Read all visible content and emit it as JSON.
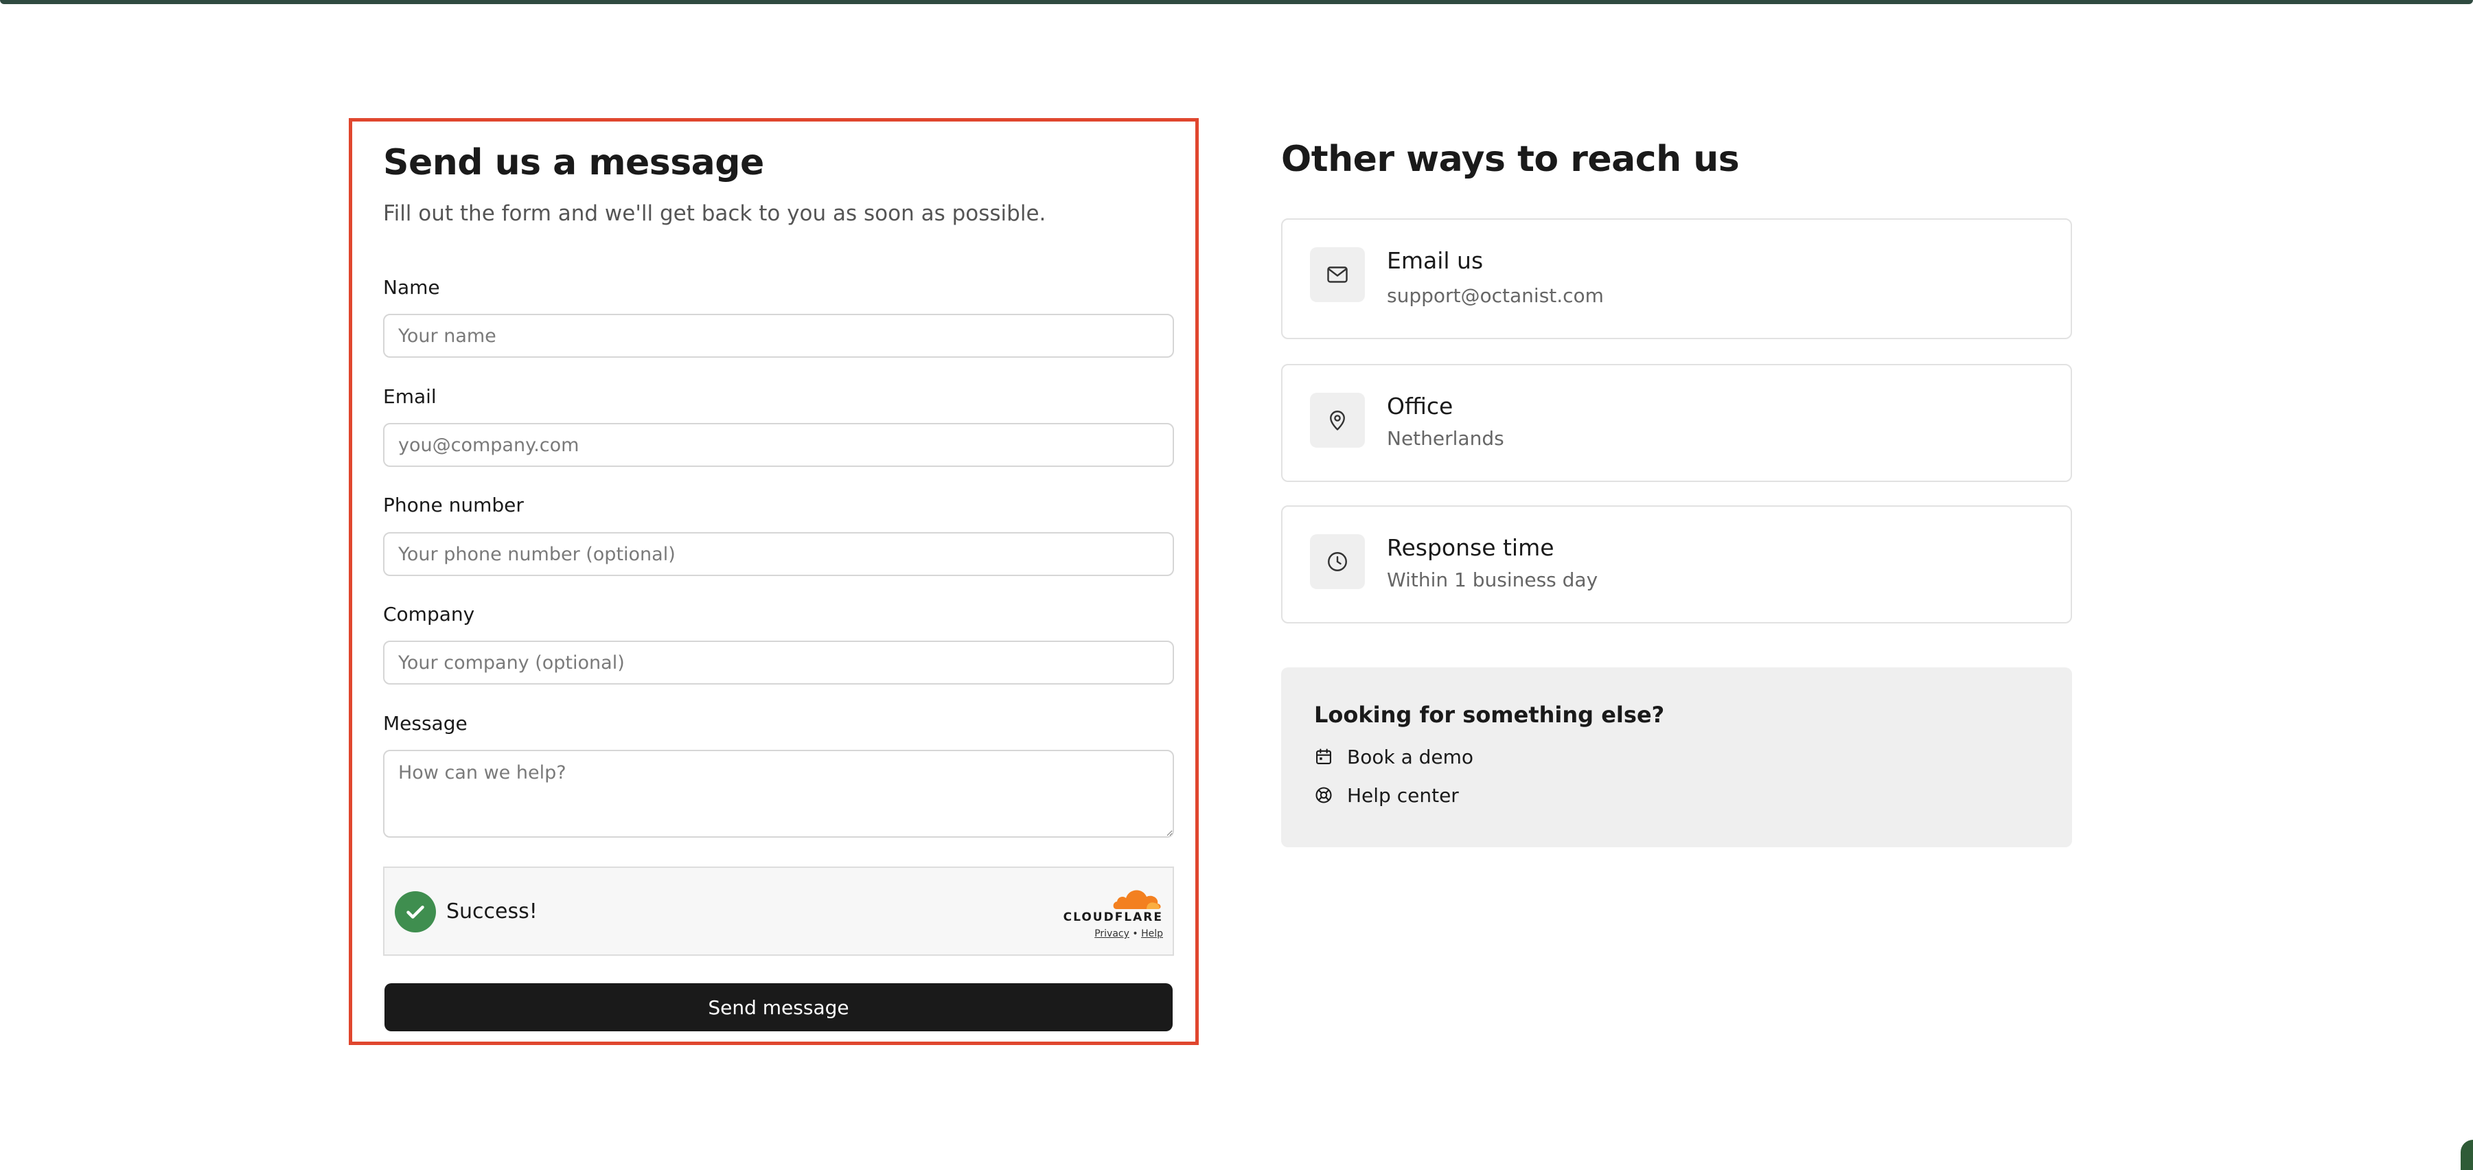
{
  "form": {
    "title": "Send us a message",
    "subtitle": "Fill out the form and we'll get back to you as soon as possible.",
    "fields": {
      "name": {
        "label": "Name",
        "placeholder": "Your name",
        "value": ""
      },
      "email": {
        "label": "Email",
        "placeholder": "you@company.com",
        "value": ""
      },
      "phone": {
        "label": "Phone number",
        "placeholder": "Your phone number (optional)",
        "value": ""
      },
      "company": {
        "label": "Company",
        "placeholder": "Your company (optional)",
        "value": ""
      },
      "message": {
        "label": "Message",
        "placeholder": "How can we help?",
        "value": ""
      }
    },
    "captcha": {
      "status": "Success!",
      "brand": "CLOUDFLARE",
      "privacy_label": "Privacy",
      "separator": "•",
      "help_label": "Help"
    },
    "submit_label": "Send message"
  },
  "contact": {
    "title": "Other ways to reach us",
    "cards": [
      {
        "icon": "mail-icon",
        "title": "Email us",
        "subtitle": "support@octanist.com"
      },
      {
        "icon": "map-pin-icon",
        "title": "Office",
        "subtitle": "Netherlands"
      },
      {
        "icon": "clock-icon",
        "title": "Response time",
        "subtitle": "Within 1 business day"
      }
    ],
    "else": {
      "title": "Looking for something else?",
      "links": [
        {
          "icon": "calendar-icon",
          "label": "Book a demo"
        },
        {
          "icon": "lifebuoy-icon",
          "label": "Help center"
        }
      ]
    }
  },
  "colors": {
    "highlight_border": "#e0462e",
    "button_bg": "#1a1a1a",
    "success_green": "#3f8e4f",
    "cloudflare_orange": "#f38020",
    "panel_bg": "#efefef"
  }
}
